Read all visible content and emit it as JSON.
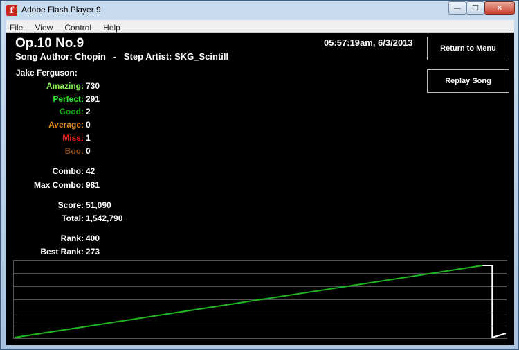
{
  "window": {
    "title": "Adobe Flash Player 9",
    "controls": {
      "minimize": "—",
      "maximize": "☐",
      "close": "✕"
    }
  },
  "menu": {
    "items": [
      "File",
      "View",
      "Control",
      "Help"
    ]
  },
  "song": {
    "title": "Op.10 No.9",
    "subtitle": "Song Author: Chopin   -   Step Artist: SKG_Scintill",
    "timestamp": "05:57:19am, 6/3/2013"
  },
  "player": {
    "name": "Jake Ferguson:"
  },
  "judgements": [
    {
      "label": "Amazing:",
      "value": "730",
      "color": "#8df05a"
    },
    {
      "label": "Perfect:",
      "value": "291",
      "color": "#2ee82e"
    },
    {
      "label": "Good:",
      "value": "2",
      "color": "#12a812"
    },
    {
      "label": "Average:",
      "value": "0",
      "color": "#e08a1e"
    },
    {
      "label": "Miss:",
      "value": "1",
      "color": "#ff1e1e"
    },
    {
      "label": "Boo:",
      "value": "0",
      "color": "#8a4a18"
    }
  ],
  "combo": [
    {
      "label": "Combo:",
      "value": "42"
    },
    {
      "label": "Max Combo:",
      "value": "981"
    }
  ],
  "score": [
    {
      "label": "Score:",
      "value": "51,090"
    },
    {
      "label": "Total:",
      "value": "1,542,790"
    }
  ],
  "rank": [
    {
      "label": "Rank:",
      "value": "400"
    },
    {
      "label": "Best Rank:",
      "value": "273"
    }
  ],
  "buttons": {
    "return": "Return to Menu",
    "replay": "Replay Song"
  },
  "graph": {
    "line_color": "#1fb81f",
    "grid_color": "#555555",
    "accuracy_line": {
      "start": 0.0,
      "end": 0.945,
      "end_fraction_of_song": 0.95
    }
  }
}
